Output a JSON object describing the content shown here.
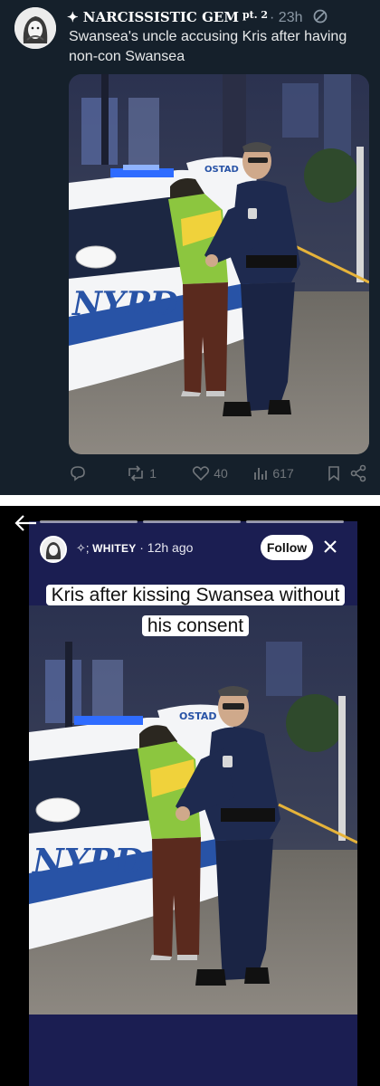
{
  "tweet": {
    "display_name": "✦ NARCISSISTIC GEM",
    "name_suffix": "pt. 2",
    "time": "· 23h",
    "text": "Swansea's uncle accusing Kris after having non-con Swansea",
    "actions": {
      "reply_count": "",
      "repost_count": "1",
      "like_count": "40",
      "views_count": "617"
    },
    "photo_sign": "NYPD"
  },
  "story": {
    "username": "WHITEY",
    "username_prefix": "✧;",
    "time": "· 12h ago",
    "follow_label": "Follow",
    "caption": "Kris after kissing Swansea without his consent",
    "photo_sign": "NYPD"
  },
  "colors": {
    "tweet_bg": "#15202b",
    "story_bg": "#1b1e52",
    "police_blue": "#1e2a4f",
    "hoodie_green": "#8cc63f"
  }
}
